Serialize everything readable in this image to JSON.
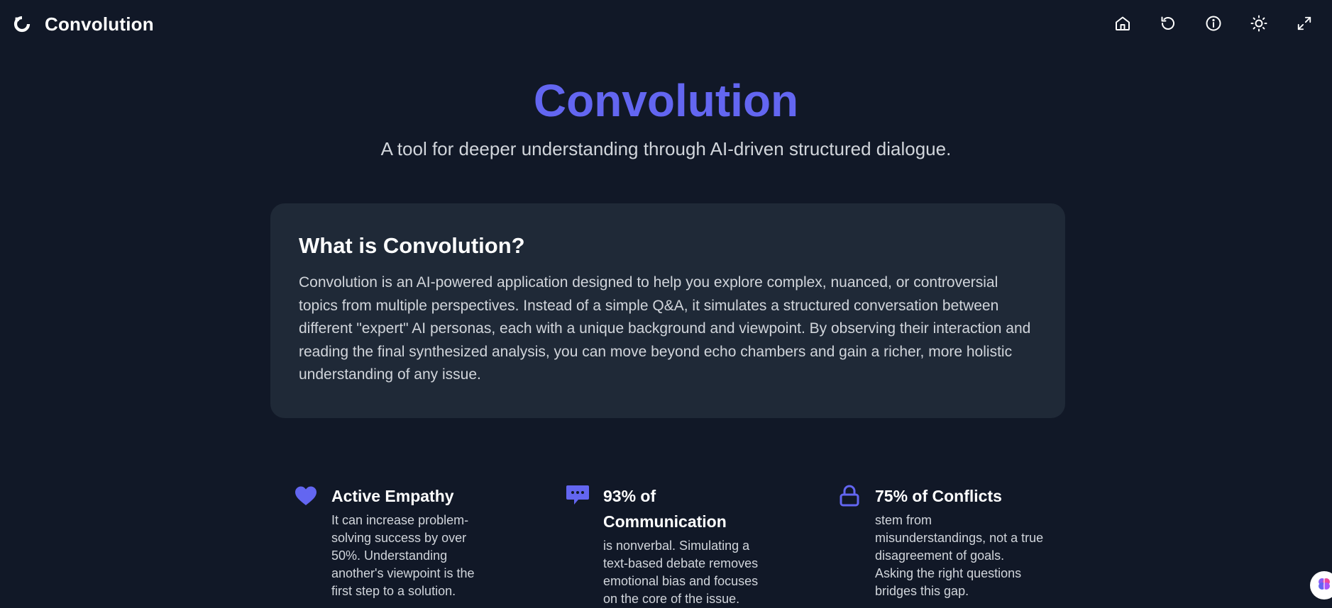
{
  "header": {
    "brand_name": "Convolution",
    "icons": [
      "home-icon",
      "history-icon",
      "info-icon",
      "sun-icon",
      "fullscreen-icon"
    ]
  },
  "hero": {
    "title": "Convolution",
    "subtitle": "A tool for deeper understanding through AI-driven structured dialogue."
  },
  "about": {
    "heading": "What is Convolution?",
    "body": "Convolution is an AI-powered application designed to help you explore complex, nuanced, or controversial topics from multiple perspectives. Instead of a simple Q&A, it simulates a structured conversation between different \"expert\" AI personas, each with a unique background and viewpoint. By observing their interaction and reading the final synthesized analysis, you can move beyond echo chambers and gain a richer, more holistic understanding of any issue."
  },
  "features": [
    {
      "icon": "heart-icon",
      "title": "Active Empathy",
      "description": "It can increase problem-solving success by over 50%. Understanding another's viewpoint is the first step to a solution."
    },
    {
      "icon": "chat-bubble-icon",
      "title": "93% of Communication",
      "description": "is nonverbal. Simulating a text-based debate removes emotional bias and focuses on the core of the issue."
    },
    {
      "icon": "lock-icon",
      "title": "75% of Conflicts",
      "description": "stem from misunderstandings, not a true disagreement of goals. Asking the right questions bridges this gap."
    }
  ],
  "colors": {
    "background": "#111827",
    "card": "#1f2937",
    "accent": "#6366f1",
    "text_primary": "#ffffff",
    "text_secondary": "#d1d5db"
  }
}
